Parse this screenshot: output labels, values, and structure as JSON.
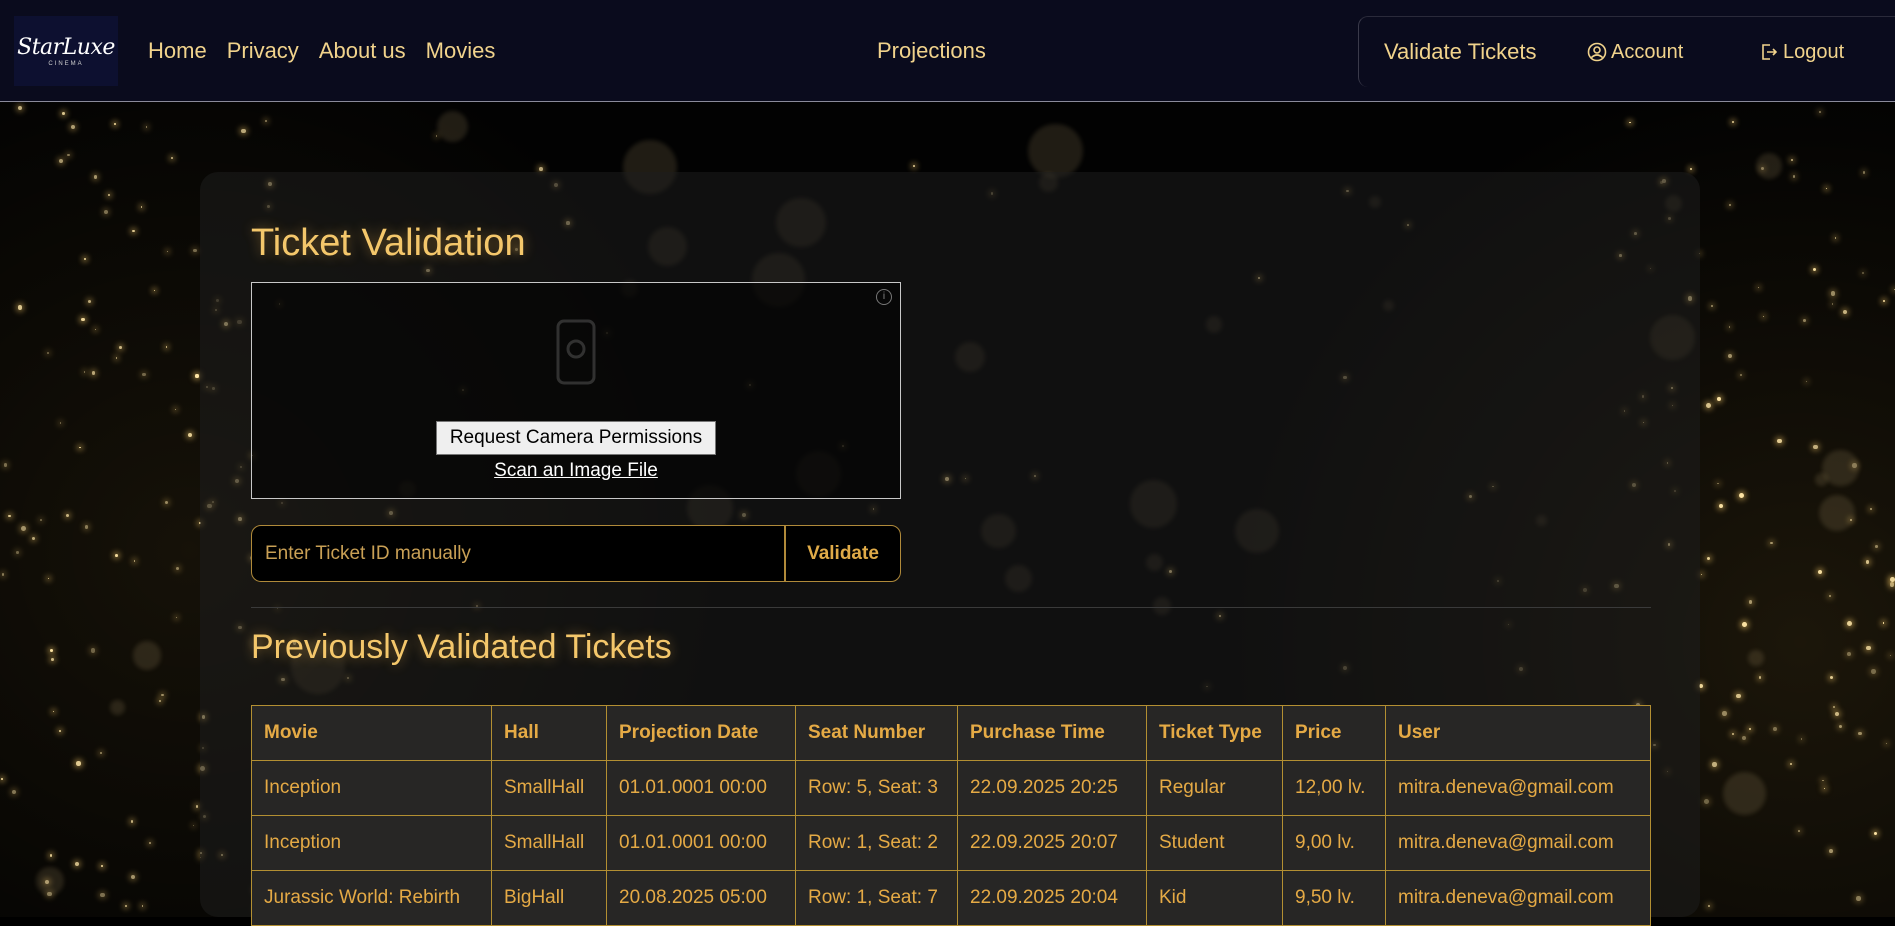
{
  "nav": {
    "logo_text": "StarLuxe",
    "logo_sub": "CINEMA",
    "links": [
      "Home",
      "Privacy",
      "About us",
      "Movies"
    ],
    "center_link": "Projections",
    "validate_tickets": "Validate Tickets",
    "account": "Account",
    "logout": "Logout",
    "account_icon": "user-circle-icon",
    "logout_icon": "logout-icon"
  },
  "main": {
    "title": "Ticket Validation",
    "scanner": {
      "camera_button": "Request Camera Permissions",
      "scan_file_link": "Scan an Image File",
      "info_icon": "info-icon",
      "camera_icon": "camera-icon"
    },
    "manual": {
      "placeholder": "Enter Ticket ID manually",
      "validate_label": "Validate"
    },
    "history_title": "Previously Validated Tickets",
    "table": {
      "columns": [
        "Movie",
        "Hall",
        "Projection Date",
        "Seat Number",
        "Purchase Time",
        "Ticket Type",
        "Price",
        "User"
      ],
      "rows": [
        [
          "Inception",
          "SmallHall",
          "01.01.0001 00:00",
          "Row: 5, Seat: 3",
          "22.09.2025 20:25",
          "Regular",
          "12,00 lv.",
          "mitra.deneva@gmail.com"
        ],
        [
          "Inception",
          "SmallHall",
          "01.01.0001 00:00",
          "Row: 1, Seat: 2",
          "22.09.2025 20:07",
          "Student",
          "9,00 lv.",
          "mitra.deneva@gmail.com"
        ],
        [
          "Jurassic World: Rebirth",
          "BigHall",
          "20.08.2025 05:00",
          "Row: 1, Seat: 7",
          "22.09.2025 20:04",
          "Kid",
          "9,50 lv.",
          "mitra.deneva@gmail.com"
        ]
      ]
    }
  },
  "colors": {
    "accent": "#f4c76b",
    "navbar_bg": "#0a0b1d",
    "table_border": "#b38f32",
    "table_text": "#e5aa45"
  }
}
